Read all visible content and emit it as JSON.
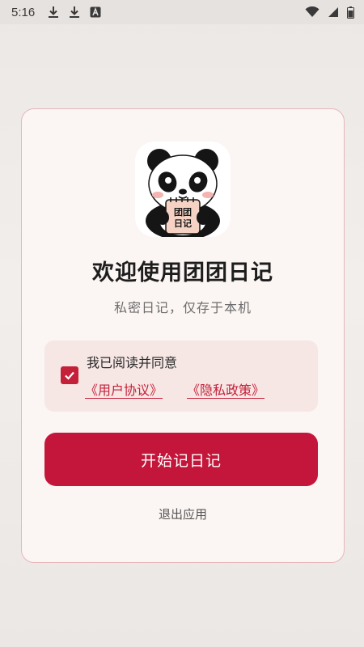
{
  "status_bar": {
    "time": "5:16",
    "left_icons": [
      "download-icon",
      "download-icon",
      "font-a-icon"
    ],
    "right_icons": [
      "wifi-icon",
      "signal-icon",
      "battery-icon"
    ]
  },
  "card": {
    "logo": {
      "icon": "panda-diary-logo-icon",
      "notebook_line1": "团团",
      "notebook_line2": "日记"
    },
    "title": "欢迎使用团团日记",
    "subtitle": "私密日记，仅存于本机",
    "agreement": {
      "checked": true,
      "text": "我已阅读并同意",
      "user_agreement": "《用户协议》",
      "privacy_policy": "《隐私政策》"
    },
    "start_button": "开始记日记",
    "exit_link": "退出应用"
  },
  "colors": {
    "accent": "#c4163a",
    "card_bg": "#fbf5f3",
    "card_border": "#e7b7b9",
    "agree_bg": "#f6e7e4"
  }
}
